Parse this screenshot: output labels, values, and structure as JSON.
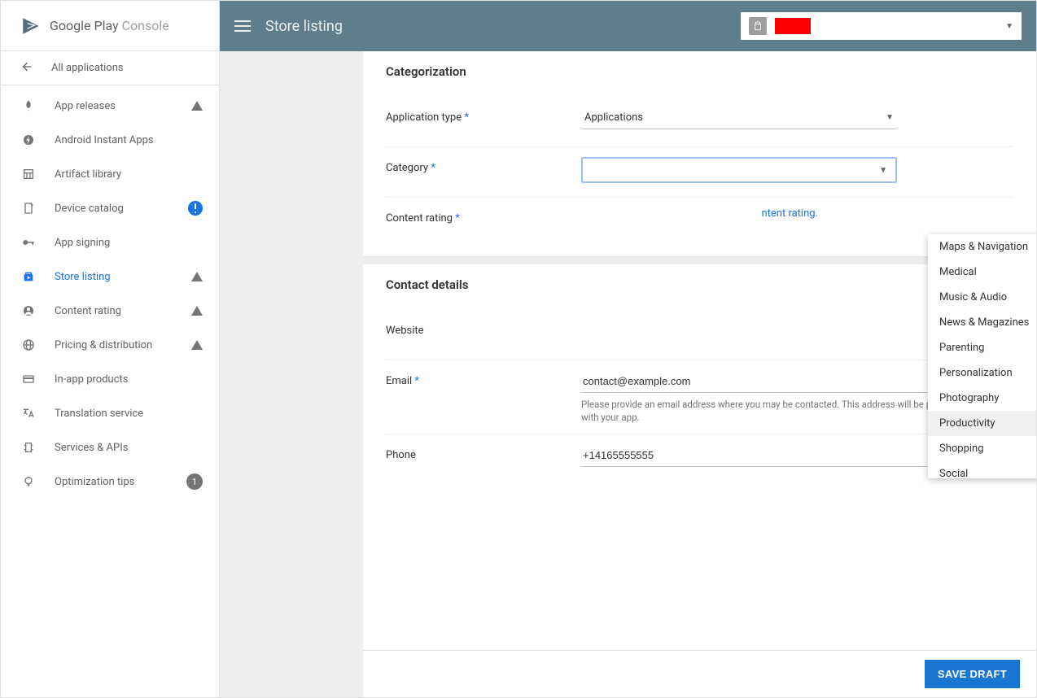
{
  "brand": {
    "name1": "Google Play ",
    "name2": "Console"
  },
  "nav": {
    "all_apps": "All applications",
    "items": [
      {
        "label": "App releases",
        "warn": true
      },
      {
        "label": "Android Instant Apps"
      },
      {
        "label": "Artifact library"
      },
      {
        "label": "Device catalog",
        "alert": true
      },
      {
        "label": "App signing"
      },
      {
        "label": "Store listing",
        "selected": true,
        "warn": true
      },
      {
        "label": "Content rating",
        "warn": true
      },
      {
        "label": "Pricing & distribution",
        "warn": true
      },
      {
        "label": "In-app products"
      },
      {
        "label": "Translation service"
      },
      {
        "label": "Services & APIs"
      },
      {
        "label": "Optimization tips",
        "count": "1"
      }
    ]
  },
  "topbar": {
    "title": "Store listing"
  },
  "sections": {
    "categorization": {
      "title": "Categorization",
      "app_type_label": "Application type",
      "app_type_value": "Applications",
      "category_label": "Category",
      "category_dropdown": {
        "options": [
          "Maps & Navigation",
          "Medical",
          "Music & Audio",
          "News & Magazines",
          "Parenting",
          "Personalization",
          "Photography",
          "Productivity",
          "Shopping",
          "Social"
        ],
        "highlighted": "Productivity"
      },
      "rating_label": "Content rating",
      "rating_link_tail": "ntent rating."
    },
    "contact": {
      "title": "Contact details",
      "website_label": "Website",
      "email_label": "Email",
      "email_value": "contact@example.com",
      "email_help": "Please provide an email address where you may be contacted. This address will be publicly displayed with your app.",
      "phone_label": "Phone",
      "phone_value": "+14165555555"
    }
  },
  "footer": {
    "save": "SAVE DRAFT"
  },
  "req": "*"
}
